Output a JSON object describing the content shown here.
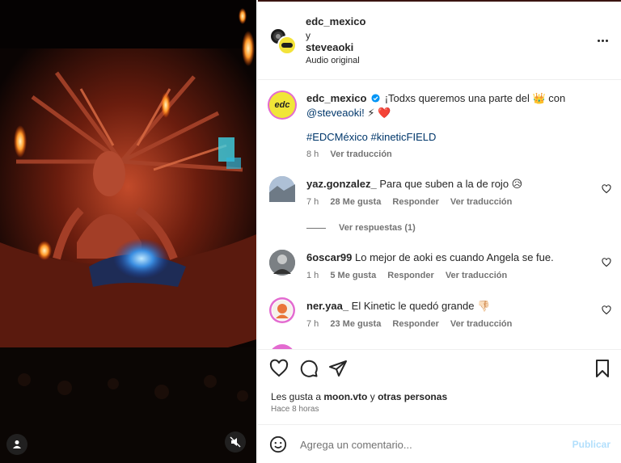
{
  "header": {
    "user1": "edc_mexico",
    "joiner": "y",
    "user2": "steveaoki",
    "audio": "Audio original"
  },
  "caption": {
    "username": "edc_mexico",
    "text": "¡Todxs queremos una parte del 👑 con",
    "mention": "@steveaoki!",
    "emojis": "⚡ ❤️",
    "hashtags": "#EDCMéxico #kineticFIELD",
    "time": "8 h",
    "translate": "Ver traducción",
    "avatar_text": "edc"
  },
  "comments": [
    {
      "username": "yaz.gonzalez_",
      "text": "Para que suben a la de rojo 😥",
      "time": "7 h",
      "likes": "28 Me gusta",
      "reply": "Responder",
      "translate": "Ver traducción"
    },
    {
      "username": "6oscar99",
      "text": "Lo mejor de aoki es cuando Angela se fue.",
      "time": "1 h",
      "likes": "5 Me gusta",
      "reply": "Responder",
      "translate": "Ver traducción"
    },
    {
      "username": "ner.yaa_",
      "text": "El Kinetic le quedó grande 👎🏻",
      "time": "7 h",
      "likes": "23 Me gusta",
      "reply": "Responder",
      "translate": "Ver traducción"
    }
  ],
  "view_replies": "Ver respuestas (1)",
  "likes": {
    "prefix": "Les gusta a",
    "user": "moon.vto",
    "middle": "y",
    "others": "otras personas"
  },
  "post_time": "Hace 8 horas",
  "add_comment": {
    "placeholder": "Agrega un comentario...",
    "publish": "Publicar"
  },
  "colors": {
    "verified": "#0095f6",
    "link": "#00376b",
    "meta": "#737373",
    "publish_disabled": "#b2dffc"
  },
  "icons": [
    "more-options-icon",
    "verified-badge-icon",
    "heart-icon",
    "comment-icon",
    "share-icon",
    "bookmark-icon",
    "emoji-icon",
    "user-tag-icon",
    "muted-audio-icon"
  ]
}
